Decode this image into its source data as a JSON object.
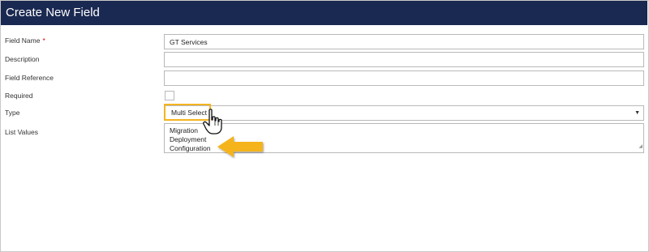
{
  "header": {
    "title": "Create New Field"
  },
  "form": {
    "field_name_label": "Field Name",
    "required_star": "*",
    "field_name_value": "GT Services",
    "description_label": "Description",
    "description_value": "",
    "field_reference_label": "Field Reference",
    "field_reference_value": "",
    "required_label": "Required",
    "required_checked": false,
    "type_label": "Type",
    "type_value": "Multi Select",
    "list_values_label": "List Values",
    "list_values": [
      "Migration",
      "Deployment",
      "Configuration"
    ]
  },
  "icons": {
    "dropdown": "chevron-down-icon",
    "cursor": "hand-pointer-icon",
    "arrow": "orange-arrow-icon",
    "resize": "resize-handle-icon"
  },
  "colors": {
    "header_bg": "#1a2951",
    "highlight": "#f5b41f",
    "required_star": "#dd0000"
  }
}
